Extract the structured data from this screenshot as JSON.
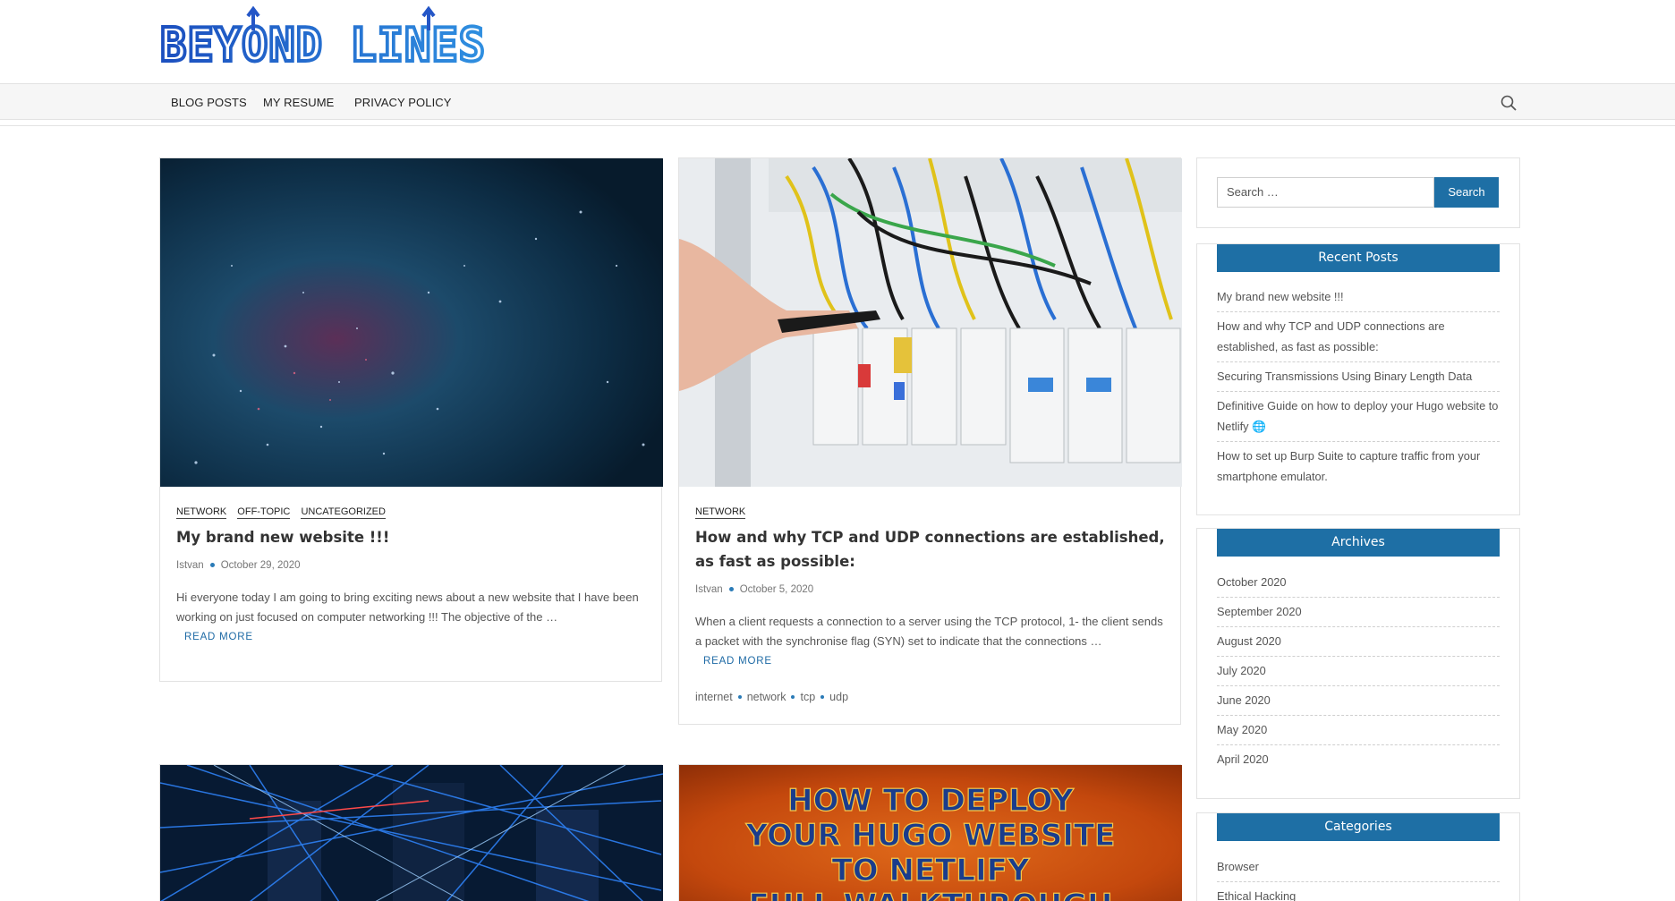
{
  "site": {
    "logo_text": "BEYOND LINES"
  },
  "nav": {
    "items": [
      "BLOG POSTS",
      "MY RESUME",
      "PRIVACY POLICY"
    ]
  },
  "posts": [
    {
      "categories": [
        "NETWORK",
        "OFF-TOPIC",
        "UNCATEGORIZED"
      ],
      "title": "My brand new website !!!",
      "author": "Istvan",
      "date": "October 29, 2020",
      "excerpt": "Hi everyone today I am going to bring exciting news about a new website that I have been working on just focused on computer networking !!! The objective of the …",
      "read_more": "READ MORE"
    },
    {
      "categories": [
        "NETWORK"
      ],
      "title": "How and why TCP and UDP connections are established, as fast as possible:",
      "author": "Istvan",
      "date": "October 5, 2020",
      "excerpt": "When a client requests a connection to a server using the TCP protocol, 1- the client sends a packet with the synchronise flag (SYN) set to indicate that the connections …",
      "read_more": "READ MORE",
      "tags": [
        "internet",
        "network",
        "tcp",
        "udp"
      ]
    }
  ],
  "bottom_posts": [
    {
      "image_text": [
        "HOW TO DEPLOY",
        "YOUR HUGO WEBSITE",
        "TO NETLIFY",
        "FULL WALKTHROUGH"
      ]
    }
  ],
  "sidebar": {
    "search": {
      "placeholder": "Search …",
      "button": "Search"
    },
    "recent_posts": {
      "title": "Recent Posts",
      "items": [
        "My brand new website !!!",
        "How and why TCP and UDP connections are established, as fast as possible:",
        "Securing Transmissions Using Binary Length Data",
        "Definitive Guide on how to deploy your Hugo website to Netlify 🌐",
        "How to set up Burp Suite to capture traffic from your smartphone emulator."
      ]
    },
    "archives": {
      "title": "Archives",
      "items": [
        "October 2020",
        "September 2020",
        "August 2020",
        "July 2020",
        "June 2020",
        "May 2020",
        "April 2020"
      ]
    },
    "categories": {
      "title": "Categories",
      "items": [
        "Browser",
        "Ethical Hacking"
      ]
    }
  },
  "colors": {
    "accent": "#1e6fa5",
    "logo": "#2e6fd0",
    "logo_outline": "#0b1f8a"
  }
}
